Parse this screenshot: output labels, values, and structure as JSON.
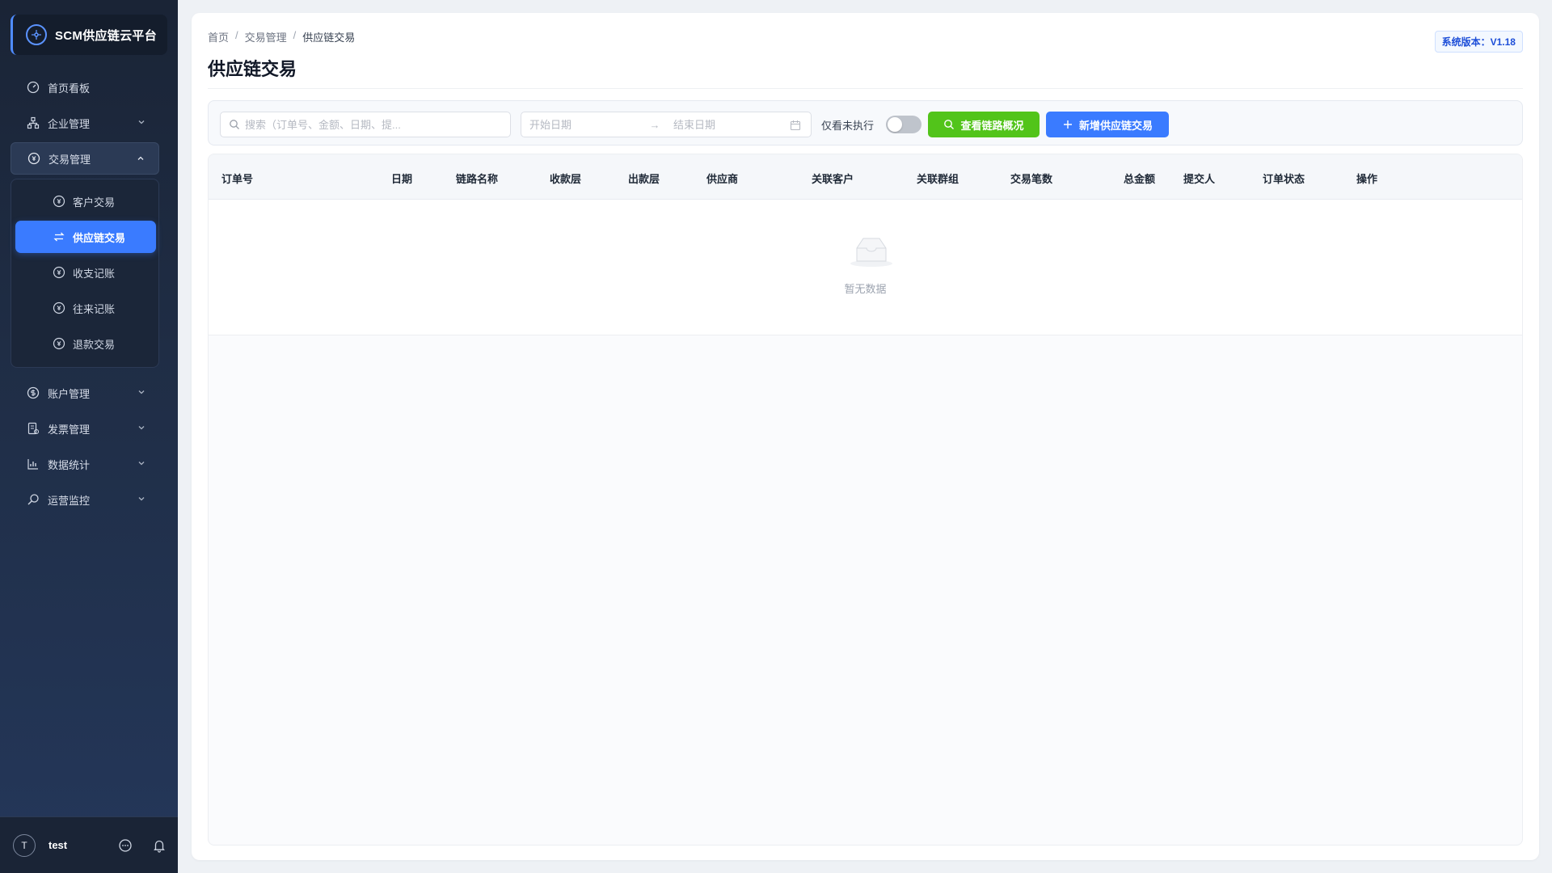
{
  "brand": {
    "title": "SCM供应链云平台"
  },
  "nav": {
    "dashboard": "首页看板",
    "enterprise": "企业管理",
    "transactions": "交易管理",
    "sub": {
      "customer": "客户交易",
      "supply_chain": "供应链交易",
      "income_expense": "收支记账",
      "receivables": "往来记账",
      "refund": "退款交易"
    },
    "accounts": "账户管理",
    "invoices": "发票管理",
    "statistics": "数据统计",
    "monitoring": "运营监控"
  },
  "user": {
    "avatar": "T",
    "name": "test"
  },
  "breadcrumb": {
    "home": "首页",
    "section": "交易管理",
    "current": "供应链交易",
    "separator": "/"
  },
  "page": {
    "title": "供应链交易",
    "version": "系统版本：V1.18"
  },
  "toolbar": {
    "search_placeholder": "搜索（订单号、金额、日期、提...",
    "start_date_placeholder": "开始日期",
    "end_date_placeholder": "结束日期",
    "date_arrow": "→",
    "only_pending_label": "仅看未执行",
    "view_chain_label": "查看链路概况",
    "add_label": "新增供应链交易"
  },
  "table": {
    "columns": [
      "订单号",
      "日期",
      "链路名称",
      "收款层",
      "出款层",
      "供应商",
      "关联客户",
      "关联群组",
      "交易笔数",
      "总金额",
      "提交人",
      "订单状态",
      "操作"
    ],
    "empty_text": "暂无数据"
  },
  "colors": {
    "sidebar_bg": "#1f2d45",
    "accent_blue": "#3a7bff",
    "accent_green": "#52c41a"
  }
}
